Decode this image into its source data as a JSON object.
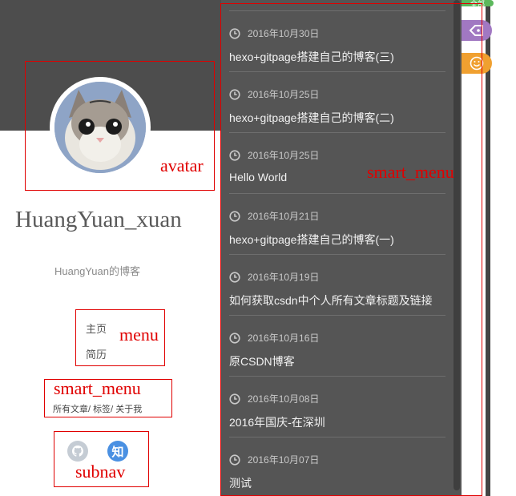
{
  "profile": {
    "name": "HuangYuan_xuan",
    "subtitle": "HuangYuan的博客"
  },
  "menu": {
    "items": [
      {
        "label": "主页"
      },
      {
        "label": "简历"
      }
    ]
  },
  "smart_links": {
    "all_posts": "所有文章/",
    "tags": "标签/",
    "about": "关于我"
  },
  "subnav": {
    "github_icon": "github-icon",
    "zhihu_label": "知"
  },
  "annotations": {
    "avatar": "avatar",
    "menu": "menu",
    "smart_menu_left": "smart_menu",
    "subnav": "subnav",
    "smart_menu_panel": "smart_menu"
  },
  "posts": [
    {
      "date": "2016年10月30日",
      "title": "hexo+gitpage搭建自己的博客(三)"
    },
    {
      "date": "2016年10月25日",
      "title": "hexo+gitpage搭建自己的博客(二)"
    },
    {
      "date": "2016年10月25日",
      "title": "Hello World"
    },
    {
      "date": "2016年10月21日",
      "title": "hexo+gitpage搭建自己的博客(一)"
    },
    {
      "date": "2016年10月19日",
      "title": "如何获取csdn中个人所有文章标题及链接"
    },
    {
      "date": "2016年10月16日",
      "title": "原CSDN博客"
    },
    {
      "date": "2016年10月08日",
      "title": "2016年国庆-在深圳"
    },
    {
      "date": "2016年10月07日",
      "title": "测试"
    }
  ],
  "side_tabs": {
    "top_label": "全部",
    "tag_icon": "tag-icon",
    "smile_icon": "smile-icon"
  },
  "colors": {
    "header_bg": "#4d4d4d",
    "panel_bg": "#555555",
    "annotation": "#e00000",
    "zhihu": "#4a90e2",
    "tab_purple": "#a178c2",
    "tab_orange": "#f0a030",
    "tab_green": "#5cb85c"
  }
}
